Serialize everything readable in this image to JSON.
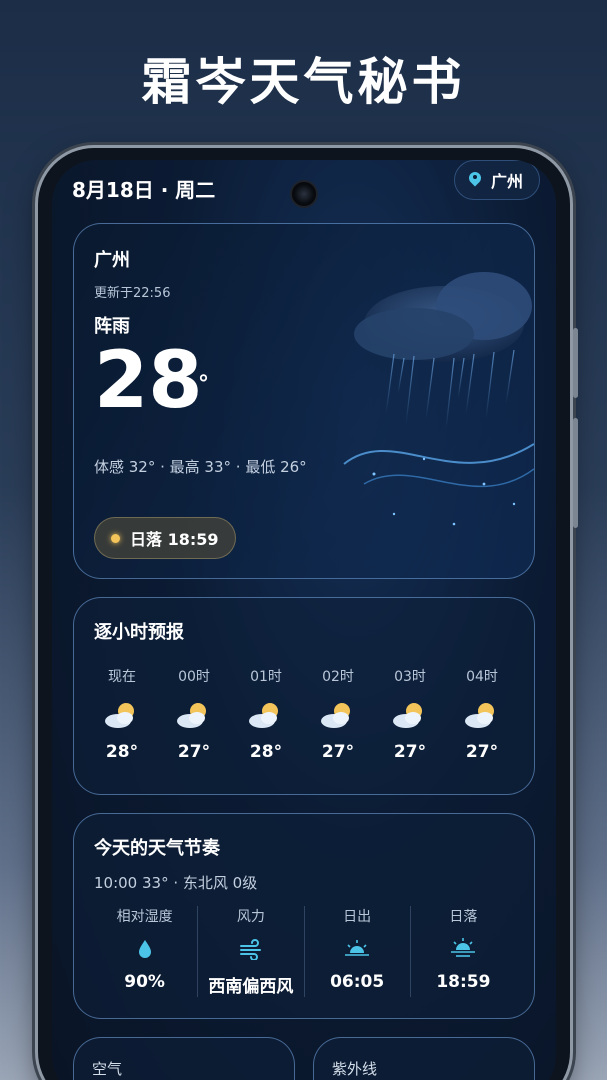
{
  "promo": {
    "title": "霜岑天气秘书"
  },
  "status": {
    "date": "8月18日 · 周二",
    "location": "广州"
  },
  "current": {
    "city": "广州",
    "updated": "更新于22:56",
    "condition": "阵雨",
    "temp": "28",
    "temp_unit": "°",
    "details": "体感 32° · 最高 33° · 最低 26°",
    "sunset_chip": "日落 18:59"
  },
  "hourly": {
    "title": "逐小时预报",
    "items": [
      {
        "label": "现在",
        "icon": "partly-cloudy-icon",
        "temp": "28°"
      },
      {
        "label": "00时",
        "icon": "partly-cloudy-icon",
        "temp": "27°"
      },
      {
        "label": "01时",
        "icon": "partly-cloudy-icon",
        "temp": "28°"
      },
      {
        "label": "02时",
        "icon": "partly-cloudy-icon",
        "temp": "27°"
      },
      {
        "label": "03时",
        "icon": "partly-cloudy-icon",
        "temp": "27°"
      },
      {
        "label": "04时",
        "icon": "partly-cloudy-icon",
        "temp": "27°"
      }
    ]
  },
  "rhythm": {
    "title": "今天的天气节奏",
    "summary": "10:00 33° · 东北风 0级",
    "stats": [
      {
        "label": "相对湿度",
        "icon": "droplet-icon",
        "value": "90%"
      },
      {
        "label": "风力",
        "icon": "wind-icon",
        "value": "西南偏西风"
      },
      {
        "label": "日出",
        "icon": "sunrise-icon",
        "value": "06:05"
      },
      {
        "label": "日落",
        "icon": "sunset-icon",
        "value": "18:59"
      }
    ]
  },
  "air": {
    "title": "空气"
  },
  "uv": {
    "title": "紫外线"
  },
  "colors": {
    "accent": "#4cc4e8",
    "sun": "#f2c45a",
    "card_border": "#78aae6"
  }
}
